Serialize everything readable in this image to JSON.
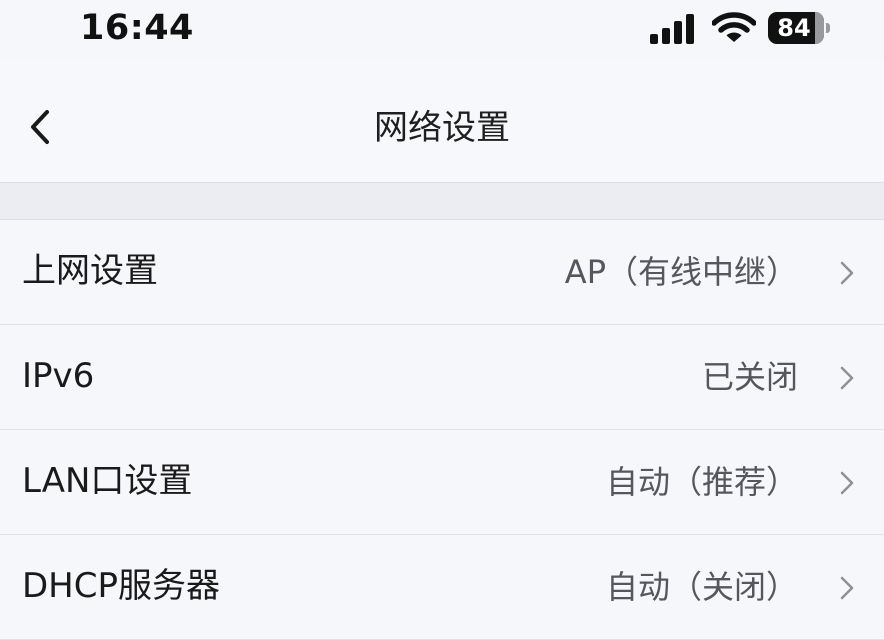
{
  "status_bar": {
    "time": "16:44",
    "battery_level": "84",
    "battery_fraction": 0.84,
    "icons": [
      "signal-bars-icon",
      "wifi-icon",
      "battery-icon"
    ]
  },
  "nav": {
    "title": "网络设置",
    "back_icon": "chevron-left-icon"
  },
  "settings": {
    "items": [
      {
        "label": "上网设置",
        "value": "AP（有线中继）"
      },
      {
        "label": "IPv6",
        "value": "已关闭"
      },
      {
        "label": "LAN口设置",
        "value": "自动（推荐）"
      },
      {
        "label": "DHCP服务器",
        "value": "自动（关闭）"
      }
    ]
  },
  "colors": {
    "background": "#f5f7fb",
    "separator": "#dcdde2",
    "value_text": "#55575c",
    "chevron": "#8e9096"
  }
}
